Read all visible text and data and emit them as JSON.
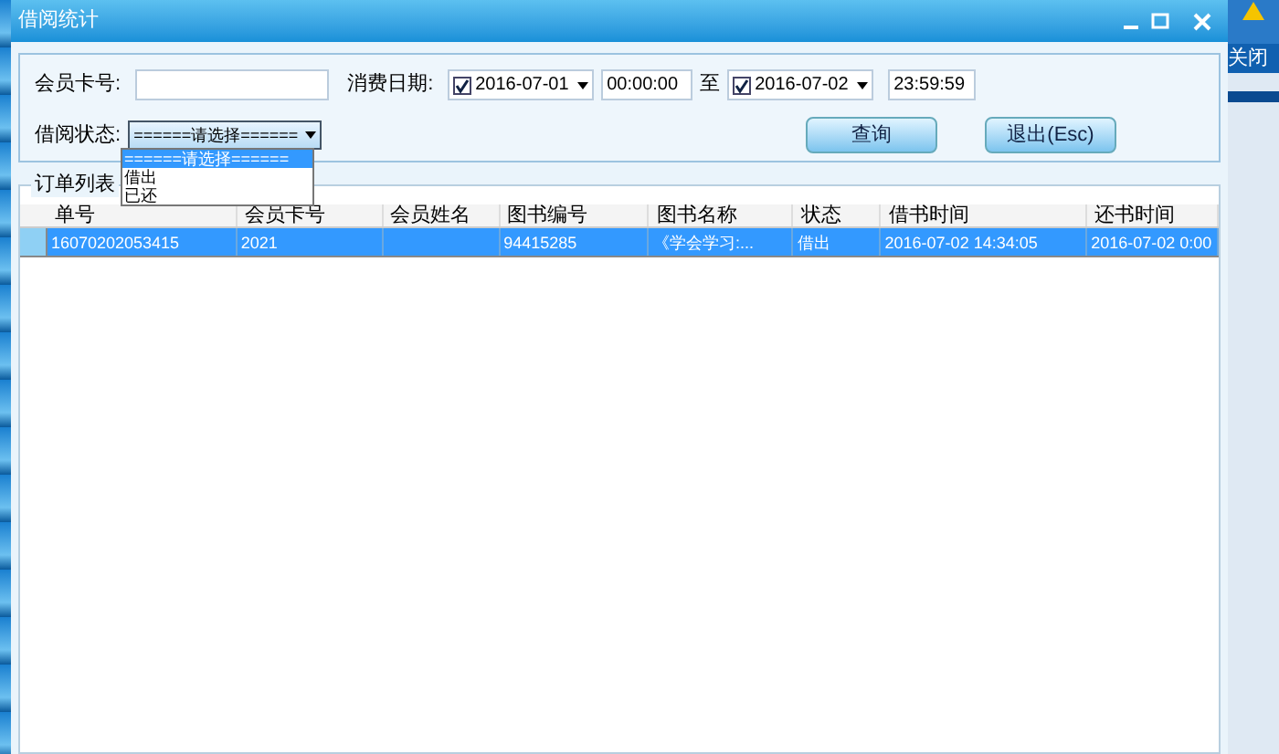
{
  "window": {
    "title": "借阅统计"
  },
  "background_app": {
    "label": "关闭"
  },
  "filters": {
    "card_label": "会员卡号:",
    "date_label": "消费日期:",
    "from_date": {
      "checked": true,
      "value": "2016-07-01"
    },
    "from_time": "00:00:00",
    "to_label": "至",
    "to_date": {
      "checked": true,
      "value": "2016-07-02"
    },
    "to_time": "23:59:59",
    "status_label": "借阅状态:",
    "status_value": "======请选择======",
    "status_options": [
      {
        "label": "======请选择======",
        "selected": true
      },
      {
        "label": "借出",
        "selected": false
      },
      {
        "label": "已还",
        "selected": false
      }
    ]
  },
  "buttons": [
    "查询",
    "退出(Esc)"
  ],
  "table": {
    "title": "订单列表",
    "columns": [
      "单号",
      "会员卡号",
      "会员姓名",
      "图书编号",
      "图书名称",
      "状态",
      "借书时间",
      "还书时间"
    ],
    "rows": [
      {
        "selected": true,
        "cells": [
          "16070202053415",
          "2021",
          "",
          "94415285",
          "《学会学习:...",
          "借出",
          "2016-07-02 14:34:05",
          "2016-07-02 0:00"
        ]
      }
    ]
  }
}
